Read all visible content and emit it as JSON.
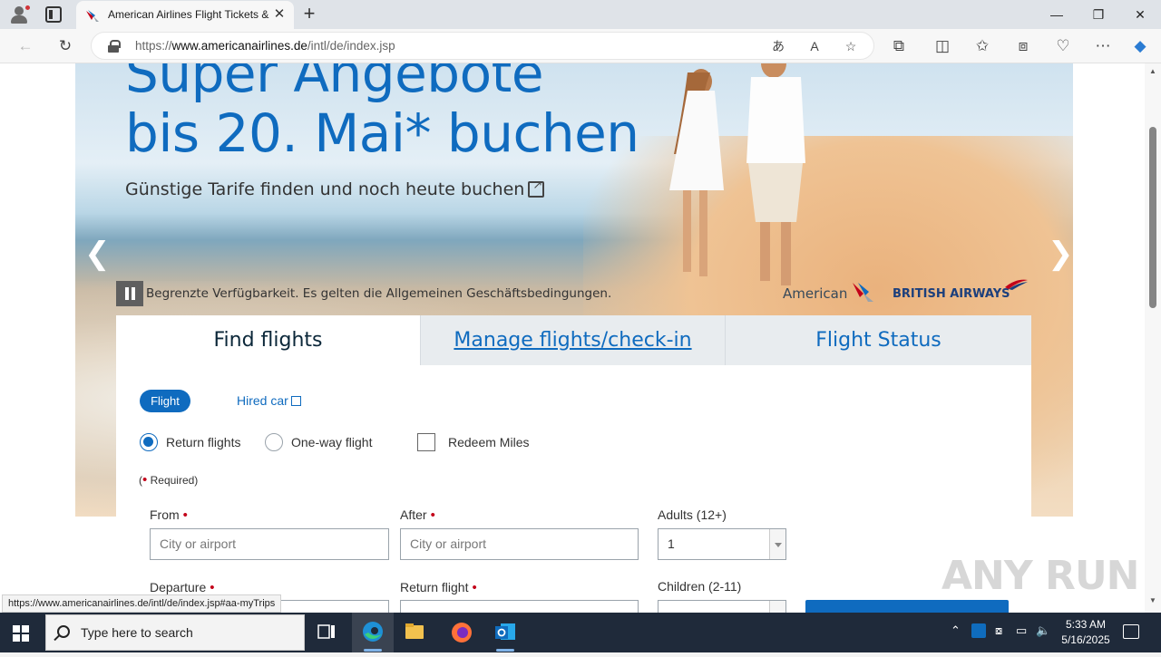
{
  "browser": {
    "tab_title": "American Airlines Flight Tickets &",
    "url_prefix": "https://",
    "url_domain": "www.americanairlines.de",
    "url_path": "/intl/de/index.jsp",
    "status_url": "https://www.americanairlines.de/intl/de/index.jsp#aa-myTrips"
  },
  "hero": {
    "title_line1": "Super Angebote",
    "title_line2": "bis 20. Mai* buchen",
    "subtitle": "Günstige Tarife finden und noch heute buchen",
    "disclaimer": "Begrenzte Verfügbarkeit. Es gelten die Allgemeinen Geschäftsbedingungen.",
    "logo_american": "American",
    "logo_ba": "BRITISH AIRWAYS",
    "arrow_left": "❮",
    "arrow_right": "❯"
  },
  "booking": {
    "tabs": [
      "Find flights",
      "Manage flights/check-in",
      "Flight Status"
    ],
    "mode_flight": "Flight",
    "mode_car": "Hired car",
    "trip_return": "Return flights",
    "trip_oneway": "One-way flight",
    "redeem": "Redeem Miles",
    "required_open": "(",
    "required_text": " Required)",
    "from_label": "From",
    "to_label": "After",
    "adults_label": "Adults (12+)",
    "from_placeholder": "City or airport",
    "to_placeholder": "City or airport",
    "adults_value": "1",
    "departure_label": "Departure",
    "return_label": "Return flight",
    "children_label": "Children (2-11)"
  },
  "watermark": "ANY RUN",
  "taskbar": {
    "search_text": "Type here to search",
    "time": "5:33 AM",
    "date": "5/16/2025"
  },
  "colors": {
    "brand_blue": "#0f6bbf",
    "required_red": "#c30019",
    "taskbar": "#1f2a3a"
  }
}
